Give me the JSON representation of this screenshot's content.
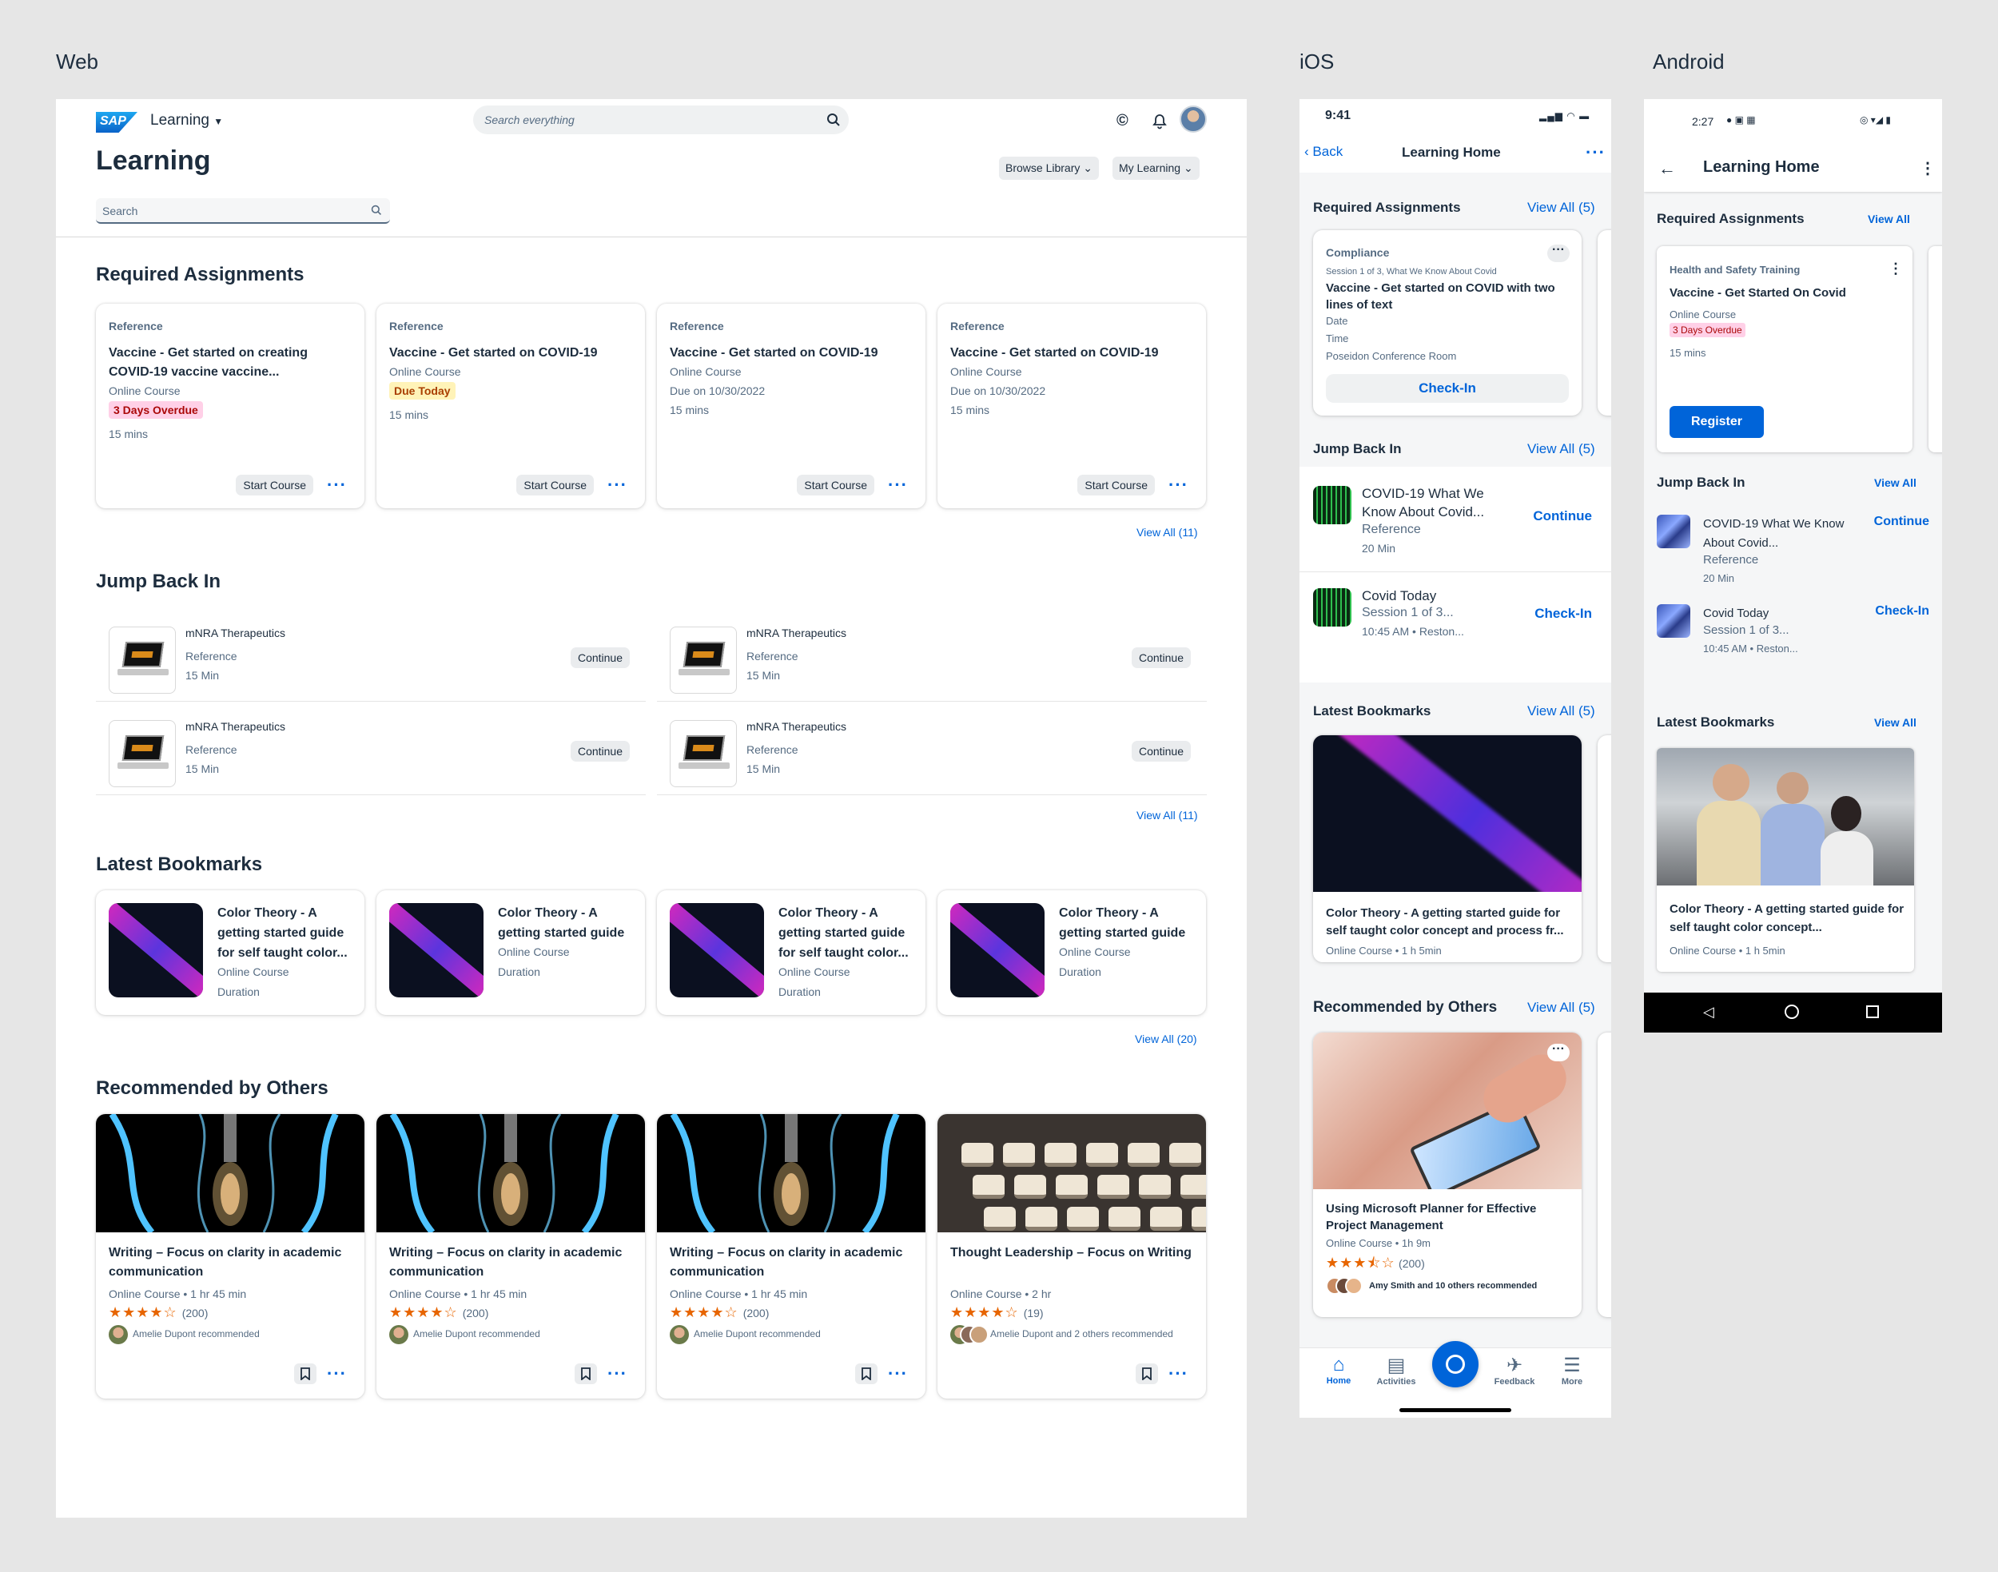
{
  "labels": {
    "web": "Web",
    "ios": "iOS",
    "android": "Android"
  },
  "web": {
    "logo": "SAP",
    "app_menu": "Learning",
    "search_placeholder": "Search everything",
    "page_title": "Learning",
    "browse_library": "Browse Library",
    "my_learning": "My Learning",
    "filter_placeholder": "Search",
    "required": {
      "title": "Required Assignments",
      "view_all": "View All (11)",
      "cards": [
        {
          "type": "Reference",
          "title": "Vaccine - Get started on creating COVID-19 vaccine vaccine...",
          "kind": "Online Course",
          "status": "3 Days Overdue",
          "due": "",
          "duration": "15 mins",
          "action": "Start Course"
        },
        {
          "type": "Reference",
          "title": "Vaccine - Get started on COVID-19",
          "kind": "Online Course",
          "status": "Due Today",
          "due": "",
          "duration": "15 mins",
          "action": "Start Course"
        },
        {
          "type": "Reference",
          "title": "Vaccine - Get started on COVID-19",
          "kind": "Online Course",
          "status": "",
          "due": "Due on 10/30/2022",
          "duration": "15 mins",
          "action": "Start Course"
        },
        {
          "type": "Reference",
          "title": "Vaccine - Get started on COVID-19",
          "kind": "Online Course",
          "status": "",
          "due": "Due on 10/30/2022",
          "duration": "15 mins",
          "action": "Start Course"
        }
      ]
    },
    "jump": {
      "title": "Jump Back In",
      "view_all": "View All (11)",
      "items": [
        {
          "title": "mNRA Therapeutics",
          "type": "Reference",
          "duration": "15 Min",
          "action": "Continue"
        },
        {
          "title": "mNRA Therapeutics",
          "type": "Reference",
          "duration": "15 Min",
          "action": "Continue"
        },
        {
          "title": "mNRA Therapeutics",
          "type": "Reference",
          "duration": "15 Min",
          "action": "Continue"
        },
        {
          "title": "mNRA Therapeutics",
          "type": "Reference",
          "duration": "15 Min",
          "action": "Continue"
        }
      ]
    },
    "bookmarks": {
      "title": "Latest Bookmarks",
      "view_all": "View All (20)",
      "items": [
        {
          "title": "Color Theory - A getting started guide for self taught color...",
          "kind": "Online Course",
          "duration": "Duration"
        },
        {
          "title": "Color Theory - A getting started guide",
          "kind": "Online Course",
          "duration": "Duration"
        },
        {
          "title": "Color Theory - A getting started guide for self taught color...",
          "kind": "Online Course",
          "duration": "Duration"
        },
        {
          "title": "Color Theory - A getting started guide",
          "kind": "Online Course",
          "duration": "Duration"
        }
      ]
    },
    "recommended": {
      "title": "Recommended by Others",
      "items": [
        {
          "title": "Writing – Focus on clarity in academic communication",
          "meta": "Online Course • 1 hr 45 min",
          "rating": 4,
          "count": "(200)",
          "by": "Amelie Dupont recommended",
          "image": "bulb"
        },
        {
          "title": "Writing – Focus on clarity in academic communication",
          "meta": "Online Course • 1 hr 45 min",
          "rating": 4,
          "count": "(200)",
          "by": "Amelie Dupont recommended",
          "image": "bulb"
        },
        {
          "title": "Writing – Focus on clarity in academic communication",
          "meta": "Online Course • 1 hr 45 min",
          "rating": 4,
          "count": "(200)",
          "by": "Amelie Dupont recommended",
          "image": "bulb"
        },
        {
          "title": "Thought Leadership – Focus on Writing",
          "meta": "Online Course • 2 hr",
          "rating": 4,
          "count": "(19)",
          "by": "Amelie Dupont and 2 others recommended",
          "image": "typewriter"
        }
      ]
    }
  },
  "ios": {
    "time": "9:41",
    "back": "Back",
    "title": "Learning Home",
    "required": {
      "title": "Required Assignments",
      "view_all": "View All (5)",
      "card": {
        "category": "Compliance",
        "session": "Session 1 of 3, What We Know About Covid",
        "title": "Vaccine - Get started on COVID with two lines of text",
        "date": "Date",
        "time": "Time",
        "place": "Poseidon Conference Room",
        "action": "Check-In"
      }
    },
    "jump": {
      "title": "Jump Back In",
      "view_all": "View All (5)",
      "items": [
        {
          "title": "COVID-19 What We Know About Covid...",
          "line2": "Reference",
          "line3": "20 Min",
          "action": "Continue"
        },
        {
          "title": "Covid Today",
          "line2": "Session 1 of 3...",
          "line3": "10:45 AM • Reston...",
          "action": "Check-In"
        }
      ]
    },
    "bookmarks": {
      "title": "Latest Bookmarks",
      "view_all": "View All (5)",
      "card": {
        "title": "Color Theory - A getting started guide for self taught color concept and process fr...",
        "meta": "Online Course  •  1 h 5min"
      }
    },
    "recommended": {
      "title": "Recommended by Others",
      "view_all": "View All (5)",
      "card": {
        "title": "Using Microsoft Planner for Effective Project Management",
        "meta": "Online Course  •  1h 9m",
        "rating": 3.5,
        "count": "(200)",
        "by": "Amy Smith and 10 others recommended"
      }
    },
    "tabs": [
      "Home",
      "Activities",
      "",
      "Feedback",
      "More"
    ]
  },
  "android": {
    "time": "2:27",
    "title": "Learning Home",
    "required": {
      "title": "Required Assignments",
      "view_all": "View All",
      "card": {
        "category": "Health and Safety Training",
        "title": "Vaccine - Get Started On Covid",
        "kind": "Online Course",
        "status": "3 Days Overdue",
        "duration": "15 mins",
        "action": "Register"
      }
    },
    "jump": {
      "title": "Jump Back In",
      "view_all": "View All",
      "items": [
        {
          "title": "COVID-19 What We Know About Covid...",
          "line2": "Reference",
          "line3": "20 Min",
          "action": "Continue"
        },
        {
          "title": "Covid Today",
          "line2": "Session 1 of 3...",
          "line3": "10:45 AM • Reston...",
          "action": "Check-In"
        }
      ]
    },
    "bookmarks": {
      "title": "Latest Bookmarks",
      "view_all": "View All",
      "card": {
        "title": "Color Theory - A getting started guide for self taught color concept...",
        "meta": "Online Course  •  1 h 5min"
      }
    }
  },
  "colors": {
    "accent": "#0064d9",
    "text": "#1d2d3e",
    "overdue": "#aa0808",
    "star": "#e76500"
  }
}
